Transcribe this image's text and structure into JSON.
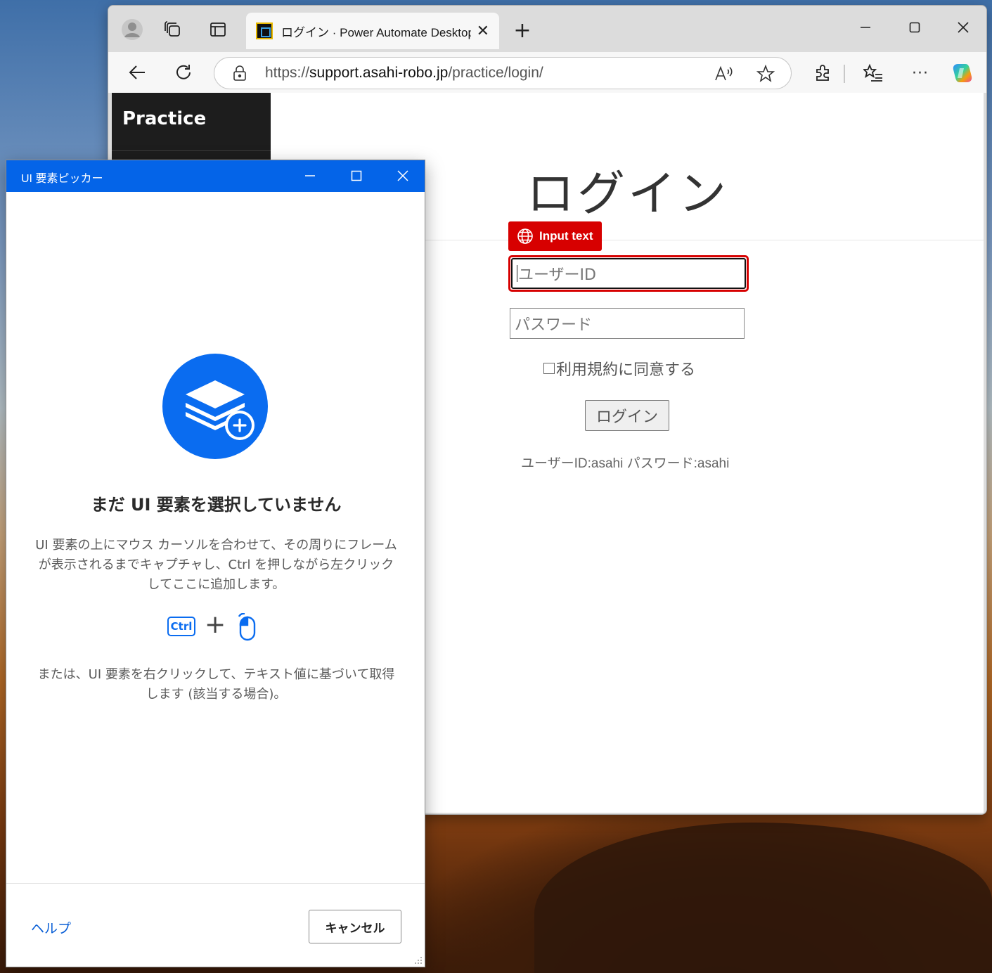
{
  "desktop": {
    "scene": "sunset-hills-wallpaper"
  },
  "browser": {
    "tab": {
      "favicon": "asahi-robo-favicon",
      "title": "ログイン · Power Automate Desktop",
      "close_icon": "close-icon"
    },
    "address": {
      "scheme": "https://",
      "host": "support.asahi-robo.jp",
      "path": "/practice/login/"
    },
    "icons": {
      "profile": "profile-icon",
      "workspaces": "workspaces-icon",
      "tab_actions": "tab-actions-icon",
      "new_tab": "plus-icon",
      "back": "back-arrow-icon",
      "refresh": "refresh-icon",
      "lock": "lock-icon",
      "read_aloud": "read-aloud-icon",
      "favorite": "star-icon",
      "extensions": "puzzle-icon",
      "favorites": "favorites-list-icon",
      "more": "more-icon",
      "copilot": "copilot-icon"
    }
  },
  "page": {
    "brand": "Practice",
    "heading": "ログイン",
    "userid_placeholder": "ユーザーID",
    "password_placeholder": "パスワード",
    "agree_label": "利用規約に同意する",
    "login_button": "ログイン",
    "hint": "ユーザーID:asahi パスワード:asahi"
  },
  "overlay": {
    "badge_label": "Input text",
    "badge_icon": "globe-icon",
    "color": "#d70000"
  },
  "picker": {
    "title": "UI 要素ピッカー",
    "empty_title": "まだ UI 要素を選択していません",
    "description": "UI 要素の上にマウス カーソルを合わせて、その周りにフレームが表示されるまでキャプチャし、Ctrl を押しながら左クリックしてここに追加します。",
    "ctrl_key": "Ctrl",
    "plus": "+",
    "alt_description": "または、UI 要素を右クリックして、テキスト値に基づいて取得します (該当する場合)。",
    "help_link": "ヘルプ",
    "cancel_button": "キャンセル",
    "accent": "#0464e8"
  }
}
